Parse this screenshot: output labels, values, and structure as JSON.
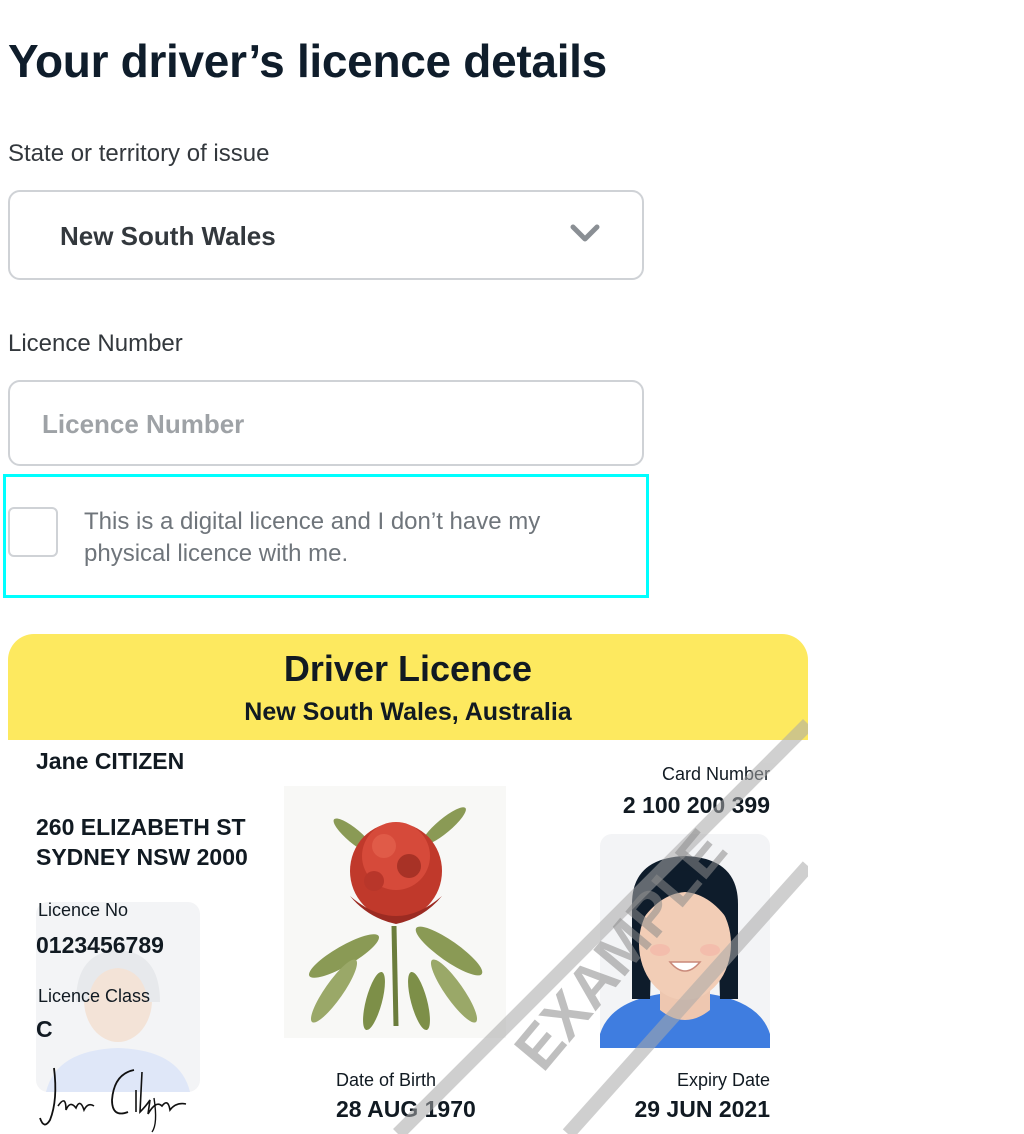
{
  "page": {
    "title": "Your driver’s licence details"
  },
  "state_field": {
    "label": "State or territory of issue",
    "selected": "New South Wales",
    "chevron_icon": "chevron-down-icon"
  },
  "licence_field": {
    "label": "Licence Number",
    "placeholder": "Licence Number",
    "value": ""
  },
  "digital_checkbox": {
    "label": "This is a digital licence and I don’t have my physical licence with me.",
    "checked": false
  },
  "card": {
    "title": "Driver Licence",
    "subtitle": "New South Wales, Australia",
    "name": "Jane CITIZEN",
    "address_line1": "260 ELIZABETH ST",
    "address_line2": "SYDNEY NSW 2000",
    "licence_no_label": "Licence No",
    "licence_no": "0123456789",
    "licence_class_label": "Licence Class",
    "licence_class": "C",
    "card_number_label": "Card Number",
    "card_number": "2 100 200 399",
    "dob_label": "Date of Birth",
    "dob": "28 AUG 1970",
    "expiry_label": "Expiry Date",
    "expiry": "29 JUN 2021",
    "signature": "Jane Citizen",
    "watermark": "EXAMPLE",
    "colors": {
      "header": "#fde95f",
      "text": "#111a22",
      "photo_shirt": "#3f7de0"
    }
  }
}
